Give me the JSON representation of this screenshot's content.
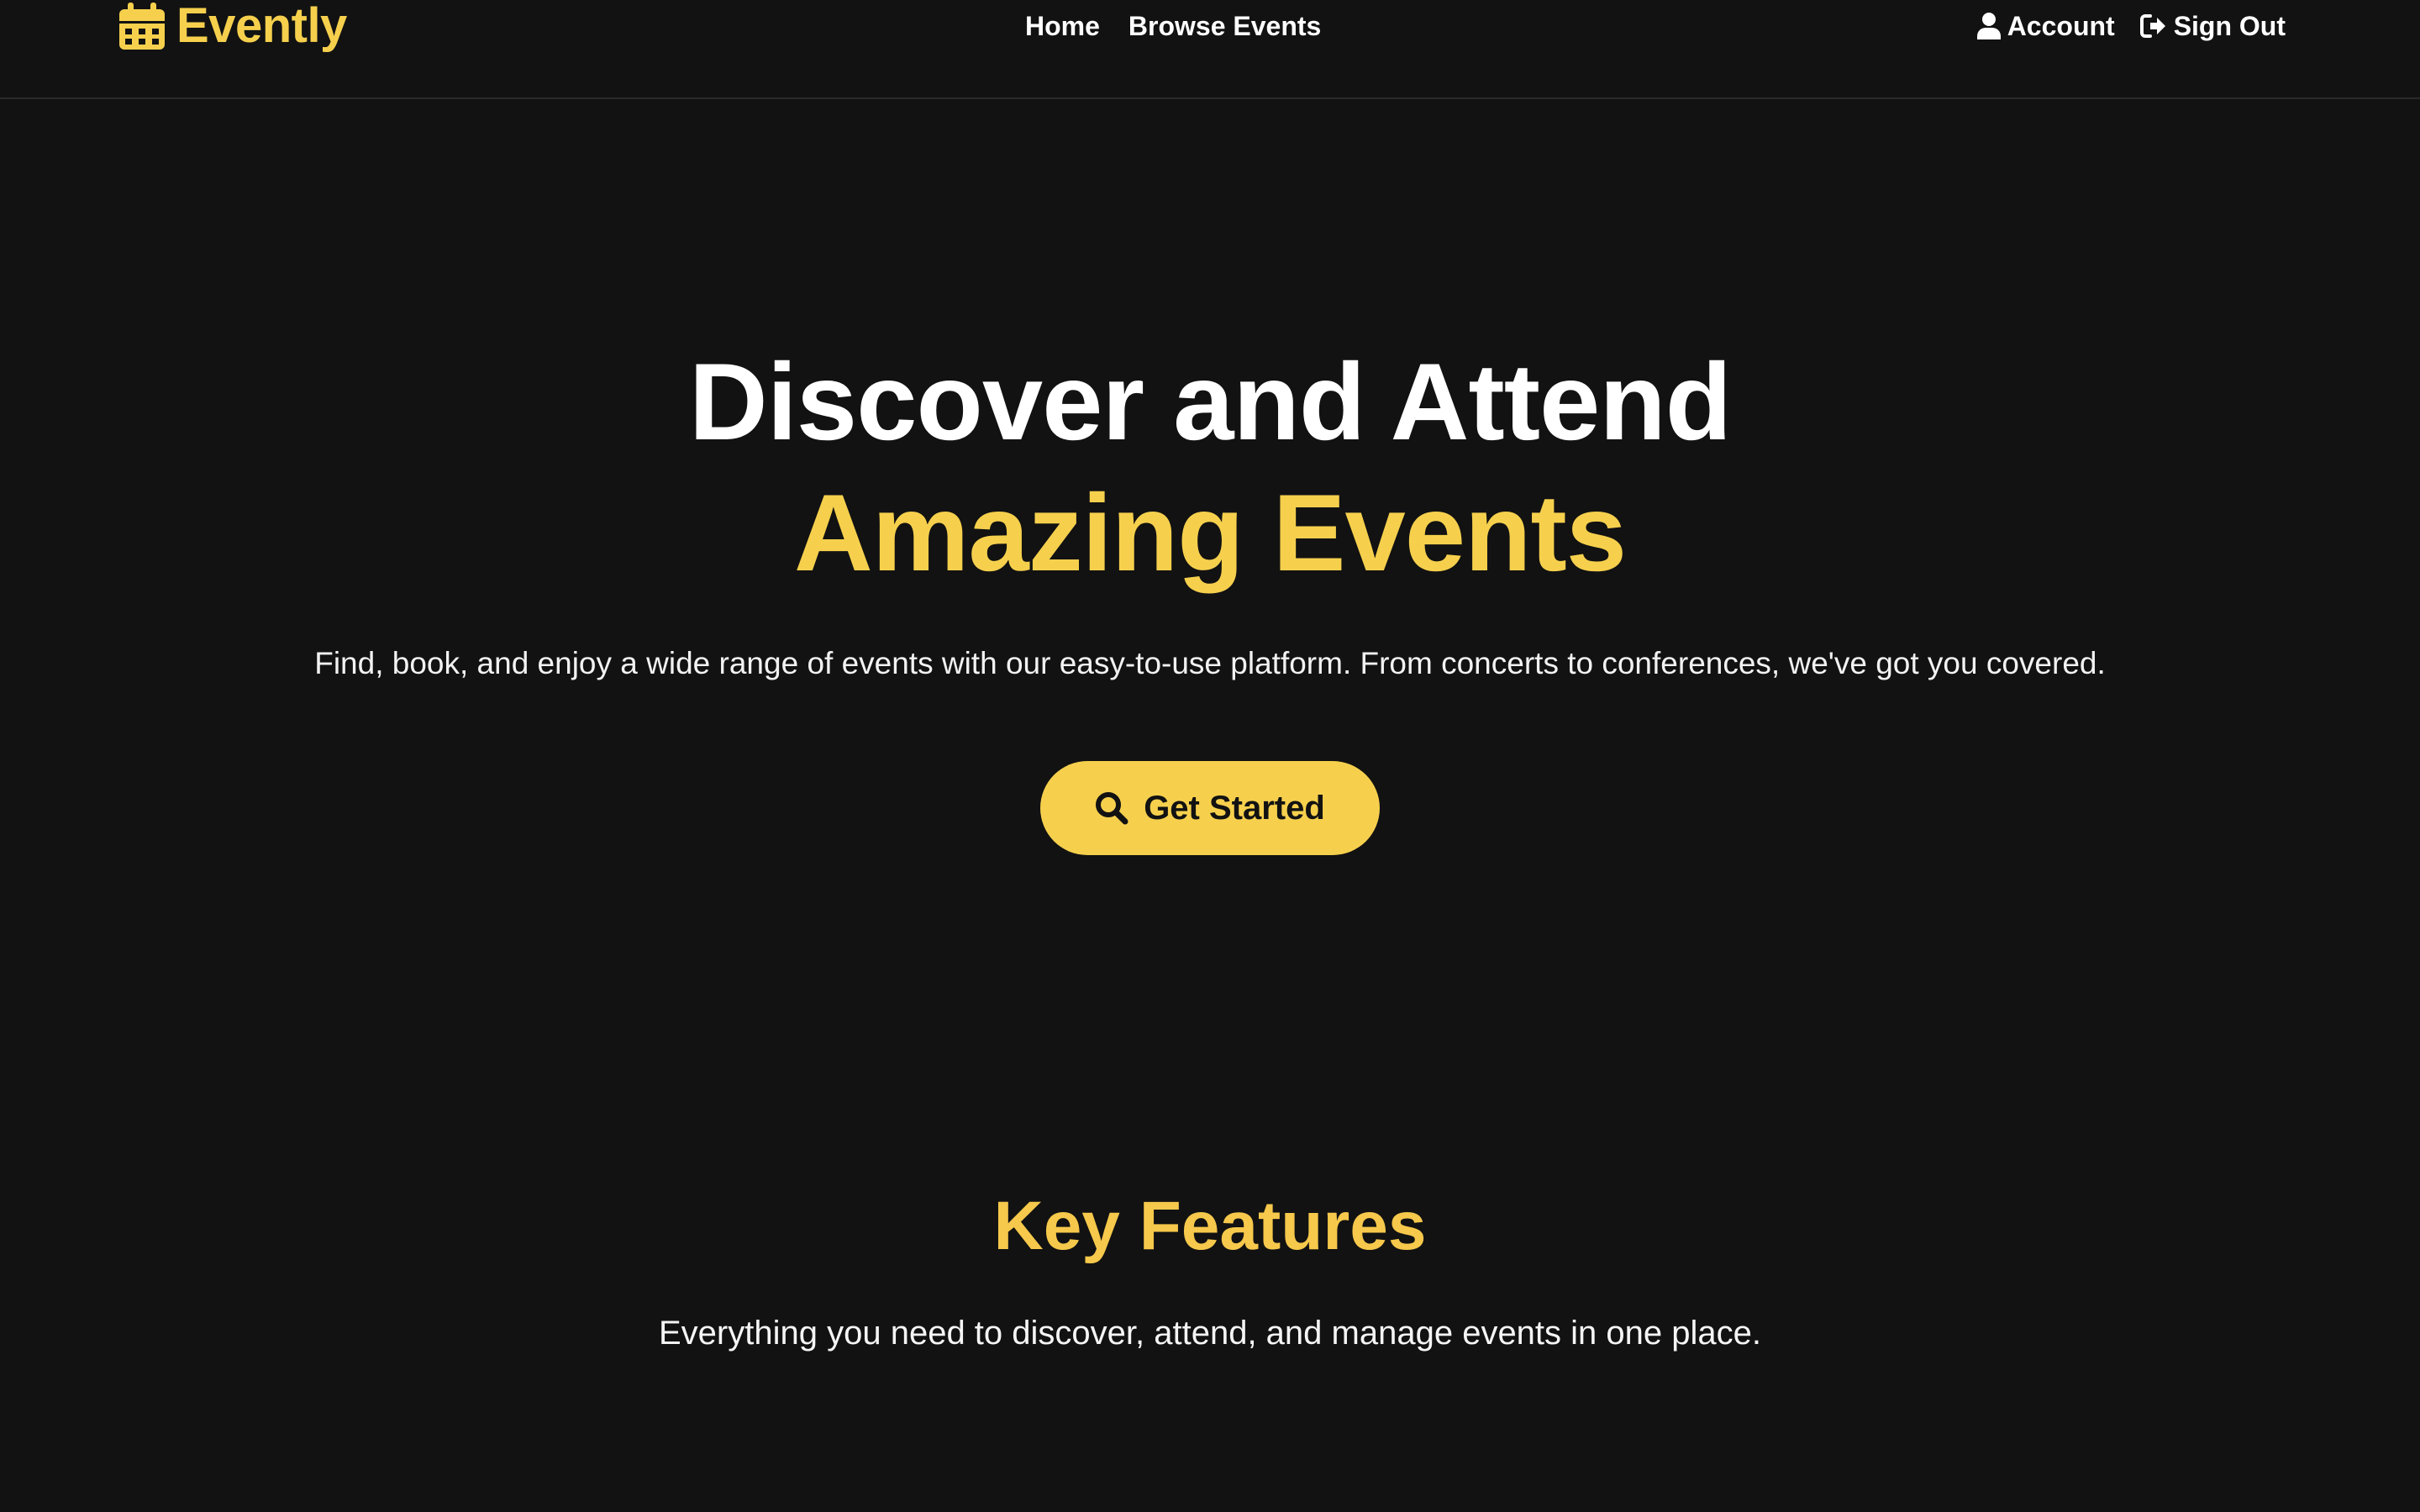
{
  "brand": {
    "name": "Evently",
    "icon": "calendar-icon",
    "color": "#f6d04d"
  },
  "nav": {
    "links": [
      {
        "label": "Home"
      },
      {
        "label": "Browse Events"
      }
    ],
    "account": {
      "label": "Account",
      "icon": "user-icon"
    },
    "signout": {
      "label": "Sign Out",
      "icon": "sign-out-icon"
    }
  },
  "hero": {
    "title_line1": "Discover and Attend",
    "title_line2": "Amazing Events",
    "subtitle": "Find, book, and enjoy a wide range of events with our easy-to-use platform. From concerts to conferences, we've got you covered.",
    "cta": {
      "label": "Get Started",
      "icon": "search-icon"
    }
  },
  "features": {
    "title": "Key Features",
    "subtitle": "Everything you need to discover, attend, and manage events in one place."
  },
  "colors": {
    "background": "#121212",
    "accent": "#f6d04d",
    "text": "#ffffff"
  }
}
